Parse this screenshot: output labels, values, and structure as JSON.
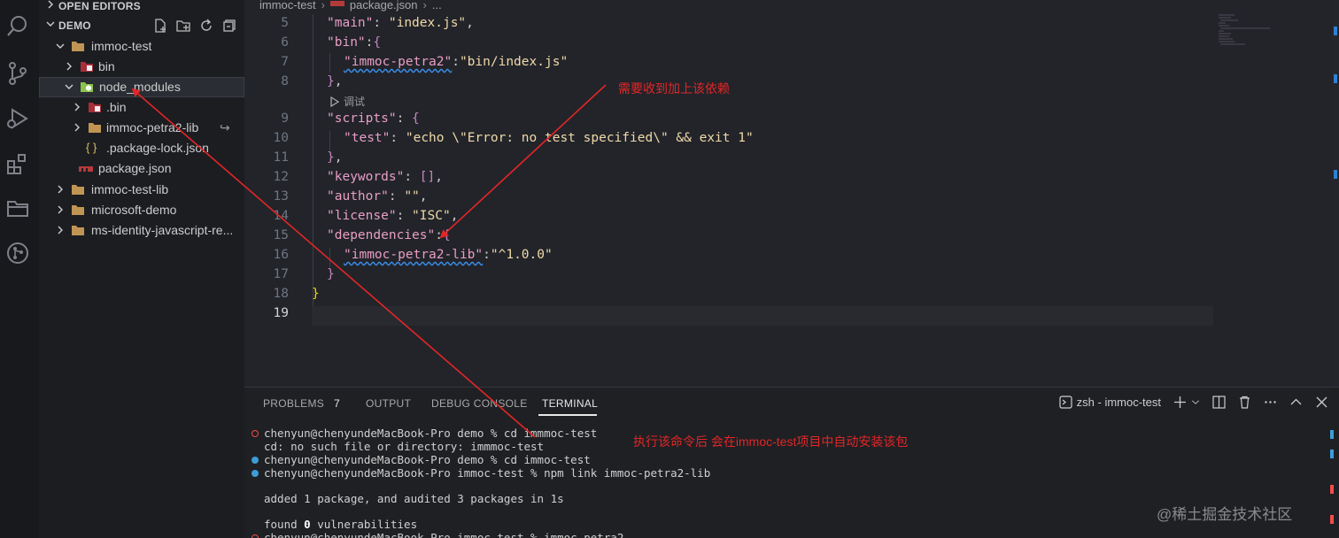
{
  "sidebar": {
    "open_editors": "OPEN EDITORS",
    "workspace": "DEMO",
    "tree": [
      {
        "label": "immoc-test",
        "kind": "folder"
      },
      {
        "label": "bin",
        "kind": "bin-folder"
      },
      {
        "label": "node_modules",
        "kind": "node-folder"
      },
      {
        "label": ".bin",
        "kind": "bin-folder"
      },
      {
        "label": "immoc-petra2-lib",
        "kind": "folder"
      },
      {
        "label": ".package-lock.json",
        "kind": "json"
      },
      {
        "label": "package.json",
        "kind": "npm"
      },
      {
        "label": "immoc-test-lib",
        "kind": "folder"
      },
      {
        "label": "microsoft-demo",
        "kind": "folder"
      },
      {
        "label": "ms-identity-javascript-re...",
        "kind": "folder"
      }
    ],
    "link_symbol": "↪"
  },
  "editor": {
    "breadcrumb": [
      "immoc-test",
      "package.json",
      "..."
    ],
    "codelens": "调试",
    "line_numbers": [
      "5",
      "6",
      "7",
      "8",
      "9",
      "10",
      "11",
      "12",
      "13",
      "14",
      "15",
      "16",
      "17",
      "18",
      "19"
    ],
    "code": {
      "l5": [
        "\"main\"",
        ": ",
        "\"index.js\"",
        ","
      ],
      "l6": [
        "\"bin\"",
        ":",
        "{"
      ],
      "l7": [
        "\"immoc-petra2\"",
        ":",
        "\"bin/index.js\""
      ],
      "l8": [
        "}",
        ","
      ],
      "l9": [
        "\"scripts\"",
        ": ",
        "{"
      ],
      "l10": [
        "\"test\"",
        ": ",
        "\"echo \\\"Error: no test specified\\\" && exit 1\""
      ],
      "l11": [
        "}",
        ","
      ],
      "l12": [
        "\"keywords\"",
        ": ",
        "[]",
        ","
      ],
      "l13": [
        "\"author\"",
        ": ",
        "\"\"",
        ","
      ],
      "l14": [
        "\"license\"",
        ": ",
        "\"ISC\"",
        ","
      ],
      "l15": [
        "\"dependencies\"",
        ":",
        "{"
      ],
      "l16": [
        "\"immoc-petra2-lib\"",
        ":",
        "\"^1.0.0\""
      ],
      "l17": [
        "}"
      ],
      "l18": [
        "}"
      ]
    }
  },
  "annotations": {
    "top": "需要收到加上该依赖",
    "bottom": "执行该命令后 会在immoc-test项目中自动安装该包"
  },
  "panel": {
    "tabs": [
      "PROBLEMS",
      "OUTPUT",
      "DEBUG CONSOLE",
      "TERMINAL"
    ],
    "problems_count": "7",
    "terminal_name": "zsh - immoc-test",
    "lines": [
      "chenyun@chenyundeMacBook-Pro demo % cd immmoc-test",
      "cd: no such file or directory: immmoc-test",
      "chenyun@chenyundeMacBook-Pro demo % cd immoc-test",
      "chenyun@chenyundeMacBook-Pro immoc-test % npm link immoc-petra2-lib",
      "added 1 package, and audited 3 packages in 1s",
      "found ",
      "0",
      " vulnerabilities",
      "chenyun@chenyundeMacBook-Pro immoc-test % immoc-petra2"
    ]
  },
  "watermark": "@稀土掘金技术社区",
  "colors": {
    "annotation": "#e22626",
    "key": "#e89ec4",
    "string": "#f0d9a8",
    "accent": "#2f7fd3"
  }
}
